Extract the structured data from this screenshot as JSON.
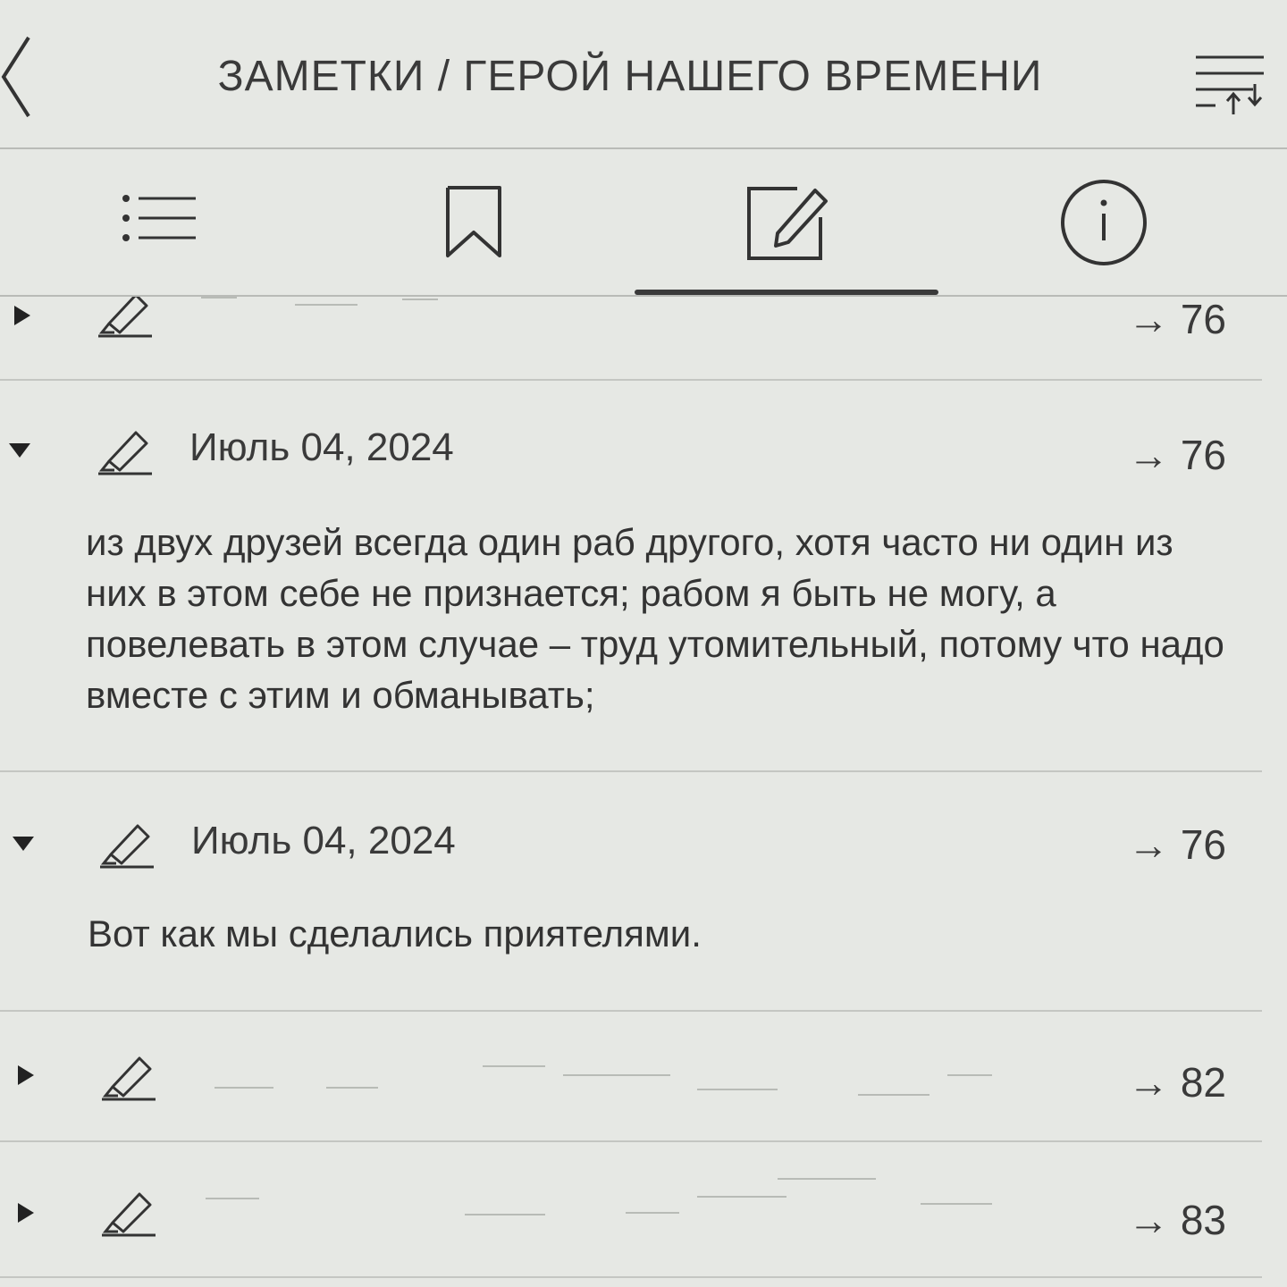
{
  "header": {
    "title": "ЗАМЕТКИ / ГЕРОЙ НАШЕГО ВРЕМЕНИ",
    "back_icon": "chevron-left-icon",
    "sort_icon": "sort-lines-icon"
  },
  "tabs": [
    {
      "icon": "table-of-contents-icon",
      "active": false
    },
    {
      "icon": "bookmark-icon",
      "active": false
    },
    {
      "icon": "note-edit-icon",
      "active": true
    },
    {
      "icon": "info-icon",
      "active": false
    }
  ],
  "notes": [
    {
      "expanded": false,
      "date": "",
      "page": "→ 76",
      "text": ""
    },
    {
      "expanded": true,
      "date": "Июль 04, 2024",
      "page": "→ 76",
      "text": "из двух друзей всегда один раб другого, хотя часто ни один из них в этом себе не признается; рабом я быть не могу, а повелевать в этом случае – труд утомительный, потому что надо вместе с этим и обманывать;"
    },
    {
      "expanded": true,
      "date": "Июль 04, 2024",
      "page": "→ 76",
      "text": "Вот как мы сделались приятелями."
    },
    {
      "expanded": false,
      "date": "",
      "page": "→ 82",
      "text": ""
    },
    {
      "expanded": false,
      "date": "",
      "page": "→ 83",
      "text": ""
    }
  ],
  "colors": {
    "background": "#e6e8e4",
    "ink": "#2a2a2a",
    "divider": "#c4c6c2"
  }
}
